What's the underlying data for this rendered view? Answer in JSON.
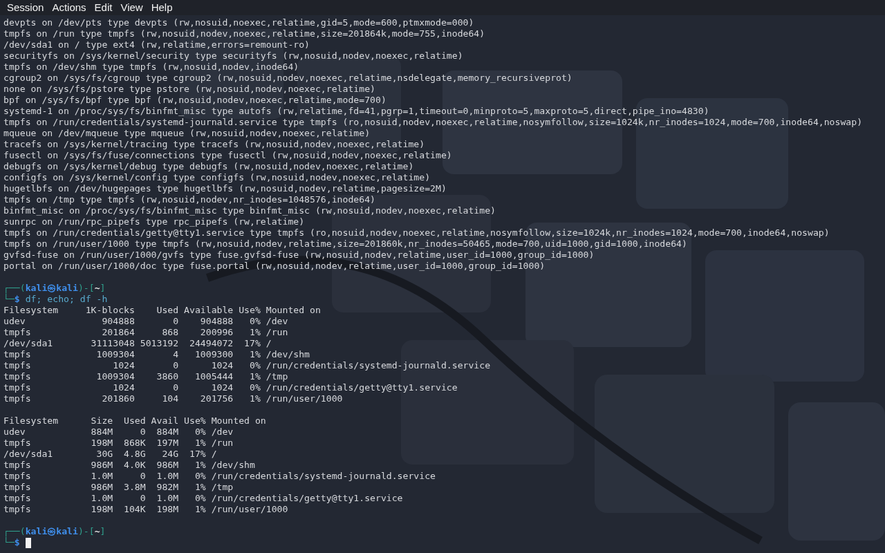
{
  "menu": [
    {
      "label": "Session"
    },
    {
      "label": "Actions"
    },
    {
      "label": "Edit"
    },
    {
      "label": "View"
    },
    {
      "label": "Help"
    }
  ],
  "blocks": [
    {
      "kind": "output",
      "lines": [
        "devpts on /dev/pts type devpts (rw,nosuid,noexec,relatime,gid=5,mode=600,ptmxmode=000)",
        "tmpfs on /run type tmpfs (rw,nosuid,nodev,noexec,relatime,size=201864k,mode=755,inode64)",
        "/dev/sda1 on / type ext4 (rw,relatime,errors=remount-ro)",
        "securityfs on /sys/kernel/security type securityfs (rw,nosuid,nodev,noexec,relatime)",
        "tmpfs on /dev/shm type tmpfs (rw,nosuid,nodev,inode64)",
        "cgroup2 on /sys/fs/cgroup type cgroup2 (rw,nosuid,nodev,noexec,relatime,nsdelegate,memory_recursiveprot)",
        "none on /sys/fs/pstore type pstore (rw,nosuid,nodev,noexec,relatime)",
        "bpf on /sys/fs/bpf type bpf (rw,nosuid,nodev,noexec,relatime,mode=700)",
        "systemd-1 on /proc/sys/fs/binfmt_misc type autofs (rw,relatime,fd=41,pgrp=1,timeout=0,minproto=5,maxproto=5,direct,pipe_ino=4830)",
        "tmpfs on /run/credentials/systemd-journald.service type tmpfs (ro,nosuid,nodev,noexec,relatime,nosymfollow,size=1024k,nr_inodes=1024,mode=700,inode64,noswap)",
        "mqueue on /dev/mqueue type mqueue (rw,nosuid,nodev,noexec,relatime)",
        "tracefs on /sys/kernel/tracing type tracefs (rw,nosuid,nodev,noexec,relatime)",
        "fusectl on /sys/fs/fuse/connections type fusectl (rw,nosuid,nodev,noexec,relatime)",
        "debugfs on /sys/kernel/debug type debugfs (rw,nosuid,nodev,noexec,relatime)",
        "configfs on /sys/kernel/config type configfs (rw,nosuid,nodev,noexec,relatime)",
        "hugetlbfs on /dev/hugepages type hugetlbfs (rw,nosuid,nodev,relatime,pagesize=2M)",
        "tmpfs on /tmp type tmpfs (rw,nosuid,nodev,nr_inodes=1048576,inode64)",
        "binfmt_misc on /proc/sys/fs/binfmt_misc type binfmt_misc (rw,nosuid,nodev,noexec,relatime)",
        "sunrpc on /run/rpc_pipefs type rpc_pipefs (rw,relatime)",
        "tmpfs on /run/credentials/getty@tty1.service type tmpfs (ro,nosuid,nodev,noexec,relatime,nosymfollow,size=1024k,nr_inodes=1024,mode=700,inode64,noswap)",
        "tmpfs on /run/user/1000 type tmpfs (rw,nosuid,nodev,relatime,size=201860k,nr_inodes=50465,mode=700,uid=1000,gid=1000,inode64)",
        "gvfsd-fuse on /run/user/1000/gvfs type fuse.gvfsd-fuse (rw,nosuid,nodev,relatime,user_id=1000,group_id=1000)",
        "portal on /run/user/1000/doc type fuse.portal (rw,nosuid,nodev,relatime,user_id=1000,group_id=1000)"
      ]
    },
    {
      "kind": "prompt",
      "top": [
        {
          "text": "┌──(",
          "kind": "frame"
        },
        {
          "text": "kali㉿kali",
          "kind": "user"
        },
        {
          "text": ")-[",
          "kind": "frame"
        },
        {
          "text": "~",
          "kind": "dir"
        },
        {
          "text": "]",
          "kind": "frame"
        }
      ],
      "bottom": [
        {
          "text": "└─",
          "kind": "frame"
        },
        {
          "text": "$",
          "kind": "sign"
        },
        {
          "text": " df; echo; df -h",
          "kind": "command"
        }
      ],
      "cursor": false
    },
    {
      "kind": "output",
      "lines": [
        "Filesystem     1K-blocks    Used Available Use% Mounted on",
        "udev              904888       0    904888   0% /dev",
        "tmpfs             201864     868    200996   1% /run",
        "/dev/sda1       31113048 5013192  24494072  17% /",
        "tmpfs            1009304       4   1009300   1% /dev/shm",
        "tmpfs               1024       0      1024   0% /run/credentials/systemd-journald.service",
        "tmpfs            1009304    3860   1005444   1% /tmp",
        "tmpfs               1024       0      1024   0% /run/credentials/getty@tty1.service",
        "tmpfs             201860     104    201756   1% /run/user/1000"
      ]
    },
    {
      "kind": "output",
      "lines": [
        "Filesystem      Size  Used Avail Use% Mounted on",
        "udev            884M     0  884M   0% /dev",
        "tmpfs           198M  868K  197M   1% /run",
        "/dev/sda1        30G  4.8G   24G  17% /",
        "tmpfs           986M  4.0K  986M   1% /dev/shm",
        "tmpfs           1.0M     0  1.0M   0% /run/credentials/systemd-journald.service",
        "tmpfs           986M  3.8M  982M   1% /tmp",
        "tmpfs           1.0M     0  1.0M   0% /run/credentials/getty@tty1.service",
        "tmpfs           198M  104K  198M   1% /run/user/1000"
      ]
    },
    {
      "kind": "prompt",
      "top": [
        {
          "text": "┌──(",
          "kind": "frame"
        },
        {
          "text": "kali㉿kali",
          "kind": "user"
        },
        {
          "text": ")-[",
          "kind": "frame"
        },
        {
          "text": "~",
          "kind": "dir"
        },
        {
          "text": "]",
          "kind": "frame"
        }
      ],
      "bottom": [
        {
          "text": "└─",
          "kind": "frame"
        },
        {
          "text": "$",
          "kind": "sign"
        }
      ],
      "cursor": true
    }
  ]
}
